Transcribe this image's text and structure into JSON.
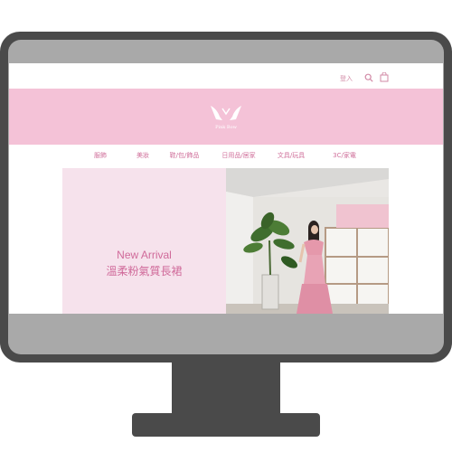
{
  "header": {
    "login_label": "登入",
    "search_icon": "search-icon",
    "cart_icon": "bag-icon"
  },
  "banner": {
    "logo_text": "Pink Bow",
    "background_color": "#f4c2d7"
  },
  "nav": {
    "items": [
      {
        "label": "服飾"
      },
      {
        "label": "美妝"
      },
      {
        "label": "鞋/包/飾品"
      },
      {
        "label": "日用品/居家"
      },
      {
        "label": "文具/玩具"
      },
      {
        "label": "3C/家電"
      }
    ]
  },
  "hero": {
    "title": "New Arrival",
    "subtitle": "溫柔粉氣質長裙",
    "accent_color": "#d06a9a",
    "panel_color": "#f6e2ec"
  }
}
